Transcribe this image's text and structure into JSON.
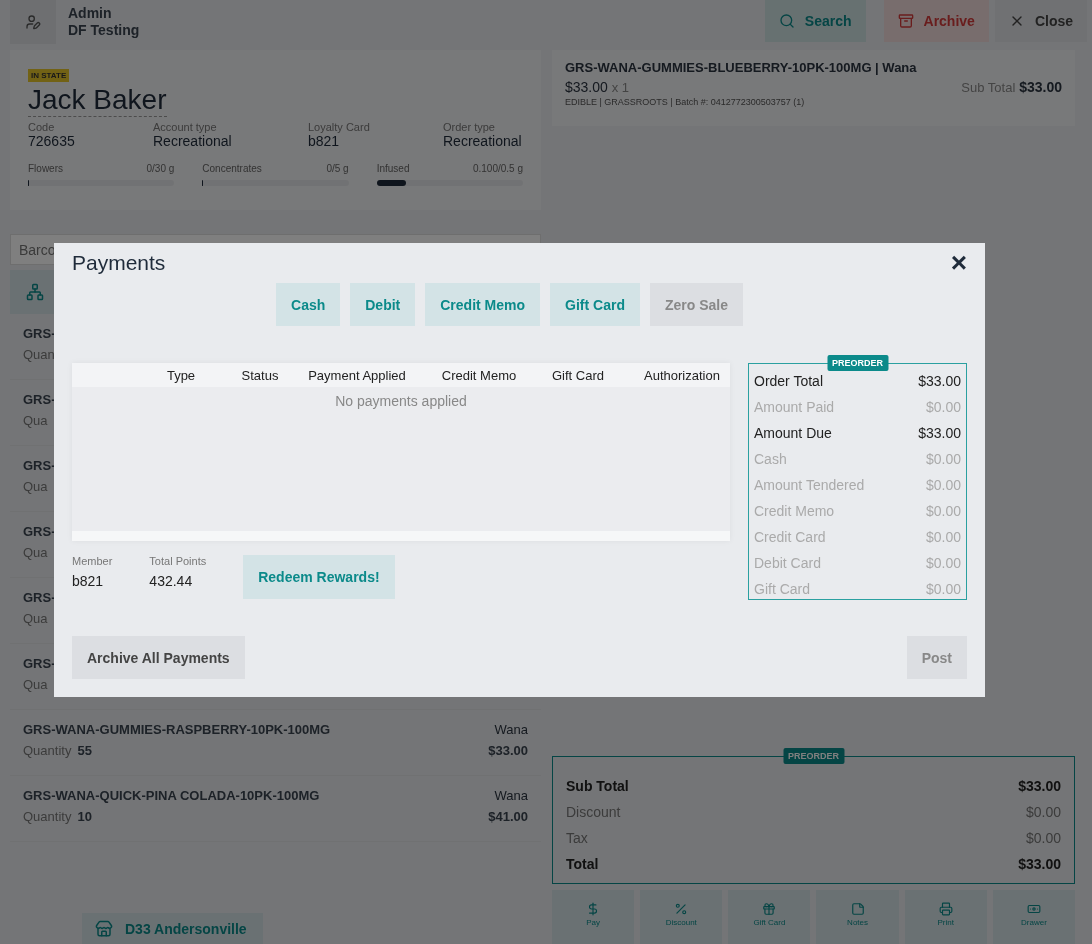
{
  "header": {
    "user": {
      "name": "Admin",
      "location": "DF Testing"
    },
    "buttons": [
      {
        "label": "Search",
        "kind": "search"
      },
      {
        "label": "Archive",
        "kind": "archive"
      },
      {
        "label": "Close",
        "kind": "close"
      }
    ]
  },
  "customer": {
    "badge": "IN STATE",
    "name": "Jack Baker",
    "fields": [
      {
        "label": "Code",
        "value": "726635"
      },
      {
        "label": "Account type",
        "value": "Recreational"
      },
      {
        "label": "Loyalty Card",
        "value": "b821"
      },
      {
        "label": "Order type",
        "value": "Recreational"
      }
    ],
    "limits": [
      {
        "label": "Flowers",
        "reading": "0/30 g",
        "level": 0
      },
      {
        "label": "Concentrates",
        "reading": "0/5 g",
        "level": 0
      },
      {
        "label": "Infused",
        "reading": "0.100/0.5 g",
        "level": 0.2
      }
    ]
  },
  "barcode": {
    "placeholder": "Barco"
  },
  "products": [
    {
      "name": "GRS-",
      "quantity_label": "Quan"
    },
    {
      "name": "GRS-",
      "quantity_label": "Qua"
    },
    {
      "name": "GRS-",
      "quantity_label": "Qua"
    },
    {
      "name": "GRS-",
      "quantity_label": "Qua"
    },
    {
      "name": "GRS-",
      "quantity_label": "Qua"
    },
    {
      "name": "GRS-",
      "quantity_label": "Qua"
    },
    {
      "name": "GRS-WANA-GUMMIES-RASPBERRY-10PK-100MG",
      "quantity_label": "Quantity",
      "quantity": "55",
      "brand": "Wana",
      "price": "$33.00"
    },
    {
      "name": "GRS-WANA-QUICK-PINA COLADA-10PK-100MG",
      "quantity_label": "Quantity",
      "quantity": "10",
      "brand": "Wana",
      "price": "$41.00"
    }
  ],
  "store": "D33 Andersonville",
  "cart_item": {
    "title": "GRS-WANA-GUMMIES-BLUEBERRY-10PK-100MG | Wana",
    "price": "$33.00",
    "qty": "x 1",
    "subtotal_label": "Sub Total",
    "subtotal": "$33.00",
    "meta": "EDIBLE | GRASSROOTS | Batch #: 0412772300503757 (1)"
  },
  "totals": {
    "badge": "PREORDER",
    "rows": [
      {
        "label": "Sub Total",
        "value": "$33.00",
        "emphasis": true
      },
      {
        "label": "Discount",
        "value": "$0.00",
        "emphasis": false
      },
      {
        "label": "Tax",
        "value": "$0.00",
        "emphasis": false
      },
      {
        "label": "Total",
        "value": "$33.00",
        "emphasis": true
      }
    ]
  },
  "actions": [
    {
      "label": "Pay",
      "kind": "pay"
    },
    {
      "label": "Discount",
      "kind": "discount"
    },
    {
      "label": "Gift Card",
      "kind": "gift"
    },
    {
      "label": "Notes",
      "kind": "notes"
    },
    {
      "label": "Print",
      "kind": "print"
    },
    {
      "label": "Drawer",
      "kind": "drawer"
    }
  ],
  "modal": {
    "title": "Payments",
    "close": "×",
    "methods": [
      {
        "label": "Cash",
        "disabled": false
      },
      {
        "label": "Debit",
        "disabled": false
      },
      {
        "label": "Credit Memo",
        "disabled": false
      },
      {
        "label": "Gift Card",
        "disabled": false
      },
      {
        "label": "Zero Sale",
        "disabled": true
      }
    ],
    "table": {
      "columns": [
        "Type",
        "Status",
        "Payment Applied",
        "Credit Memo",
        "Gift Card",
        "Authorization"
      ],
      "empty": "No payments applied"
    },
    "member_label": "Member",
    "member": "b821",
    "points_label": "Total Points",
    "points": "432.44",
    "redeem": "Redeem Rewards!",
    "summary": {
      "badge": "PREORDER",
      "rows": [
        {
          "label": "Order Total",
          "value": "$33.00",
          "emphasis": true
        },
        {
          "label": "Amount Paid",
          "value": "$0.00",
          "emphasis": false
        },
        {
          "label": "Amount Due",
          "value": "$33.00",
          "emphasis": true
        },
        {
          "label": "Cash",
          "value": "$0.00",
          "emphasis": false
        },
        {
          "label": "Amount Tendered",
          "value": "$0.00",
          "emphasis": false
        },
        {
          "label": "Credit Memo",
          "value": "$0.00",
          "emphasis": false
        },
        {
          "label": "Credit Card",
          "value": "$0.00",
          "emphasis": false
        },
        {
          "label": "Debit Card",
          "value": "$0.00",
          "emphasis": false
        },
        {
          "label": "Gift Card",
          "value": "$0.00",
          "emphasis": false
        }
      ]
    },
    "archive": "Archive All Payments",
    "post": {
      "label": "Post",
      "disabled": true
    }
  }
}
